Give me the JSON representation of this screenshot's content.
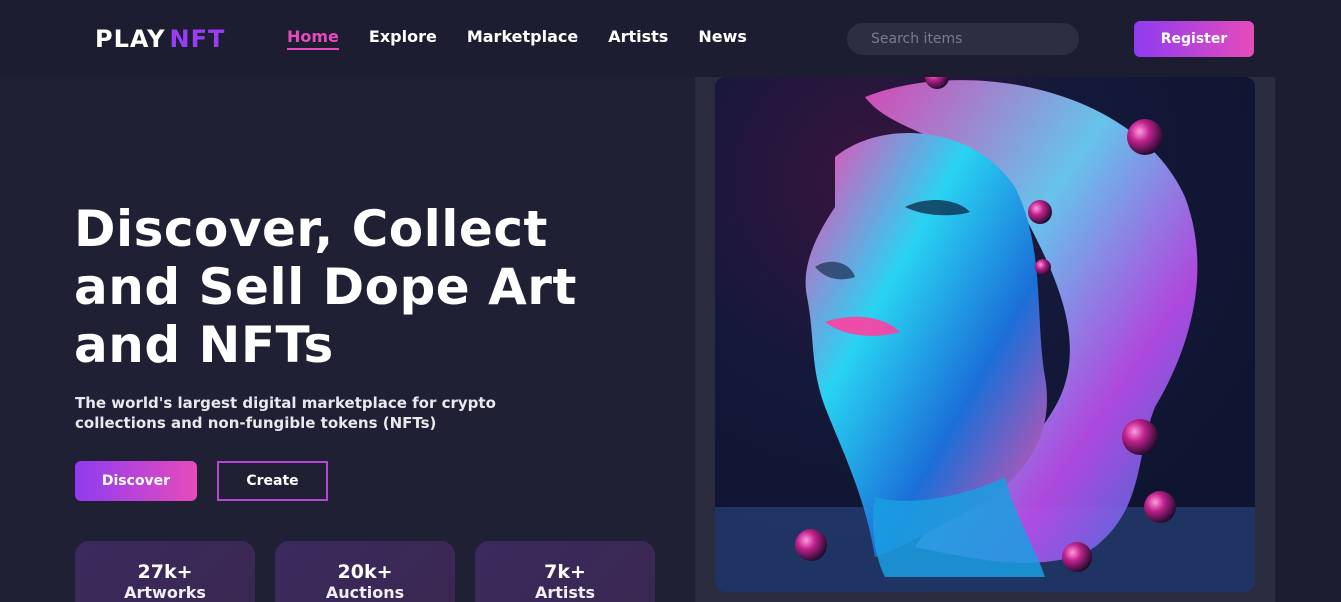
{
  "navbar": {
    "logo_part1": "PLAY",
    "logo_part2": "NFT",
    "links": [
      "Home",
      "Explore",
      "Marketplace",
      "Artists",
      "News"
    ],
    "active_link": "Home",
    "search_placeholder": "Search items",
    "register_label": "Register"
  },
  "hero": {
    "title_line1": "Discover, Collect",
    "title_line2": "and Sell Dope Art",
    "title_line3": "and NFTs",
    "subtitle_line1": "The world's largest digital marketplace for crypto",
    "subtitle_line2": "collections and non-fungible tokens (NFTs)",
    "discover_label": "Discover",
    "create_label": "Create"
  },
  "stats": [
    {
      "value": "27k+",
      "label": "Artworks"
    },
    {
      "value": "20k+",
      "label": "Auctions"
    },
    {
      "value": "7k+",
      "label": "Artists"
    }
  ],
  "colors": {
    "background": "#1f2033",
    "accent_purple": "#8e3cf1",
    "accent_pink": "#e64bbb"
  }
}
